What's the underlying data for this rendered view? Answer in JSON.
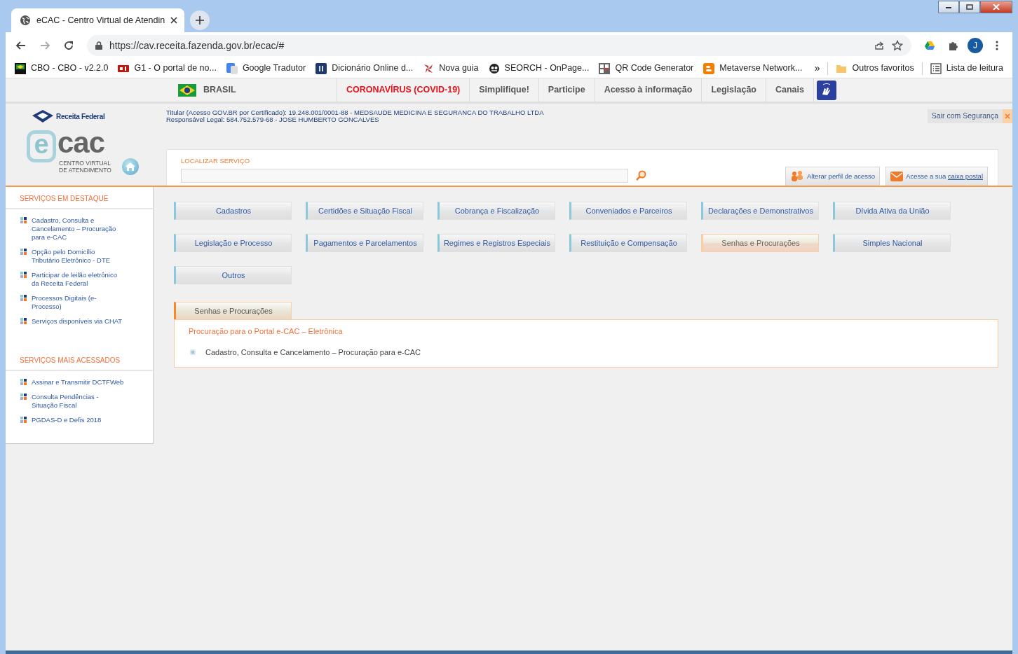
{
  "window": {
    "tab_title": "eCAC - Centro Virtual de Atendin",
    "url": "https://cav.receita.fazenda.gov.br/ecac/#",
    "profile_initial": "J"
  },
  "bookmarks": [
    {
      "label": "CBO - CBO - v2.2.0",
      "kind": "mte"
    },
    {
      "label": "G1 - O portal de no...",
      "kind": "g1"
    },
    {
      "label": "Google Tradutor",
      "kind": "translate"
    },
    {
      "label": "Dicionário Online d...",
      "kind": "dictionary"
    },
    {
      "label": "Nova guia",
      "kind": "pinwheel"
    },
    {
      "label": "SEORCH - OnPage...",
      "kind": "face"
    },
    {
      "label": "QR Code Generator",
      "kind": "qr"
    },
    {
      "label": "Metaverse Network...",
      "kind": "blogger"
    }
  ],
  "bookmarks_more": "»",
  "bookmark_extras": [
    {
      "label": "Outros favoritos",
      "kind": "folder"
    },
    {
      "label": "Lista de leitura",
      "kind": "list"
    }
  ],
  "gov_bar": {
    "country": "BRASIL",
    "links": [
      {
        "label": "CORONAVÍRUS (COVID-19)",
        "kind": "alert"
      },
      {
        "label": "Simplifique!",
        "kind": "plain"
      },
      {
        "label": "Participe",
        "kind": "plain"
      },
      {
        "label": "Acesso à informação",
        "kind": "plain"
      },
      {
        "label": "Legislação",
        "kind": "plain"
      },
      {
        "label": "Canais",
        "kind": "plain"
      }
    ]
  },
  "header": {
    "brand": "Receita Federal",
    "logo_letter": "e",
    "logo_word": "cac",
    "logo_tagline": [
      "CENTRO VIRTUAL",
      "DE ATENDIMENTO"
    ],
    "user_lines": [
      "Titular (Acesso GOV.BR por Certificado): 19.248.001/0001-88 - MEDSAUDE MEDICINA E SEGURANCA DO TRABALHO LTDA",
      "Responsável Legal: 584.752.579-68 - JOSE HUMBERTO GONCALVES"
    ],
    "logout": "Sair com Segurança"
  },
  "search": {
    "label": "LOCALIZAR SERVIÇO",
    "profile_button": "Alterar perfil de acesso",
    "mail_button": "Acesse a sua ",
    "mail_link": "caixa postal"
  },
  "sidebar": [
    {
      "title": "SERVIÇOS EM DESTAQUE",
      "items": [
        "Cadastro, Consulta e Cancelamento – Procuração para e-CAC",
        "Opção pelo Domicílio Tributário Eletrônico - DTE",
        "Participar de leilão eletrônico da Receita Federal",
        "Processos Digitais (e-Processo)",
        "Serviços disponíveis via CHAT"
      ]
    },
    {
      "title": "SERVIÇOS MAIS ACESSADOS",
      "items": [
        "Assinar e Transmitir DCTFWeb",
        "Consulta Pendências - Situação Fiscal",
        "PGDAS-D e Defis 2018"
      ]
    }
  ],
  "categories": [
    {
      "label": "Cadastros",
      "selected": false
    },
    {
      "label": "Certidões e Situação Fiscal",
      "selected": false
    },
    {
      "label": "Cobrança e Fiscalização",
      "selected": false
    },
    {
      "label": "Conveniados e Parceiros",
      "selected": false
    },
    {
      "label": "Declarações e Demonstrativos",
      "selected": false
    },
    {
      "label": "Dívida Ativa da União",
      "selected": false
    },
    {
      "label": "Legislação e Processo",
      "selected": false
    },
    {
      "label": "Pagamentos e Parcelamentos",
      "selected": false
    },
    {
      "label": "Regimes e Registros Especiais",
      "selected": false
    },
    {
      "label": "Restituição e Compensação",
      "selected": false
    },
    {
      "label": "Senhas e Procurações",
      "selected": true
    },
    {
      "label": "Simples Nacional",
      "selected": false
    },
    {
      "label": "Outros",
      "selected": false
    }
  ],
  "panel": {
    "tab": "Senhas e Procurações",
    "heading": "Procuração para o Portal e-CAC – Eletrônica",
    "items": [
      "Cadastro, Consulta e Cancelamento – Procuração para e-CAC"
    ]
  }
}
